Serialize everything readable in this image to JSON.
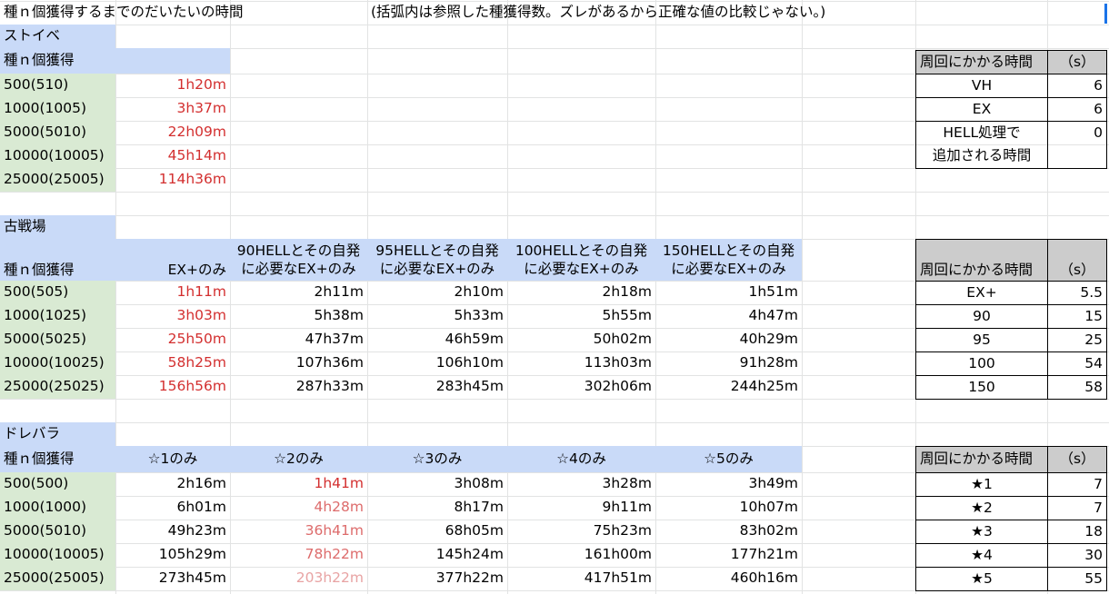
{
  "title": "種ｎ個獲得するまでのだいたいの時間",
  "note": "(括弧内は参照した種獲得数。ズレがあるから正確な値の比較じゃない。)",
  "sections": [
    {
      "name": "ストイベ",
      "header": [
        "種ｎ個獲得",
        ""
      ],
      "rows": [
        [
          "500(510)",
          "1h20m"
        ],
        [
          "1000(1005)",
          "3h37m"
        ],
        [
          "5000(5010)",
          "22h09m"
        ],
        [
          "10000(10005)",
          "45h14m"
        ],
        [
          "25000(25005)",
          "114h36m"
        ]
      ],
      "side": {
        "header": [
          "周回にかかる時間",
          "（s）"
        ],
        "rows": [
          [
            "VH",
            "6"
          ],
          [
            "EX",
            "6"
          ],
          [
            "HELL処理で",
            "0"
          ],
          [
            "追加される時間",
            ""
          ]
        ]
      }
    },
    {
      "name": "古戦場",
      "header": [
        "種ｎ個獲得",
        "EX+のみ",
        "90HELLとその自発\nに必要なEX+のみ",
        "95HELLとその自発\nに必要なEX+のみ",
        "100HELLとその自発\nに必要なEX+のみ",
        "150HELLとその自発\nに必要なEX+のみ"
      ],
      "rows": [
        [
          "500(505)",
          "1h11m",
          "2h11m",
          "2h10m",
          "2h18m",
          "1h51m"
        ],
        [
          "1000(1025)",
          "3h03m",
          "5h38m",
          "5h33m",
          "5h55m",
          "4h47m"
        ],
        [
          "5000(5025)",
          "25h50m",
          "47h37m",
          "46h59m",
          "50h02m",
          "40h29m"
        ],
        [
          "10000(10025)",
          "58h25m",
          "107h36m",
          "106h10m",
          "113h03m",
          "91h28m"
        ],
        [
          "25000(25025)",
          "156h56m",
          "287h33m",
          "283h45m",
          "302h06m",
          "244h25m"
        ]
      ],
      "side": {
        "header": [
          "周回にかかる時間",
          "（s）"
        ],
        "rows": [
          [
            "EX+",
            "5.5"
          ],
          [
            "90",
            "15"
          ],
          [
            "95",
            "25"
          ],
          [
            "100",
            "54"
          ],
          [
            "150",
            "58"
          ]
        ]
      }
    },
    {
      "name": "ドレバラ",
      "header": [
        "種ｎ個獲得",
        "☆1のみ",
        "☆2のみ",
        "☆3のみ",
        "☆4のみ",
        "☆5のみ"
      ],
      "rows": [
        [
          "500(500)",
          "2h16m",
          "1h41m",
          "3h08m",
          "3h28m",
          "3h49m"
        ],
        [
          "1000(1000)",
          "6h01m",
          "4h28m",
          "8h17m",
          "9h11m",
          "10h07m"
        ],
        [
          "5000(5010)",
          "49h23m",
          "36h41m",
          "68h05m",
          "75h23m",
          "83h02m"
        ],
        [
          "10000(10005)",
          "105h29m",
          "78h22m",
          "145h24m",
          "161h00m",
          "177h21m"
        ],
        [
          "25000(25005)",
          "273h45m",
          "203h22m",
          "377h22m",
          "417h51m",
          "460h16m"
        ]
      ],
      "side": {
        "header": [
          "周回にかかる時間",
          "（s）"
        ],
        "rows": [
          [
            "★1",
            "7"
          ],
          [
            "★2",
            "7"
          ],
          [
            "★3",
            "18"
          ],
          [
            "★4",
            "30"
          ],
          [
            "★5",
            "55"
          ]
        ]
      }
    }
  ],
  "colors": {
    "header_blue": "#c9daf8",
    "row_green": "#d9ead3",
    "side_gray": "#cccccc",
    "red": "#d32f2f",
    "pink": "#dd6b6b",
    "light_pink": "#e8a3a3",
    "gridline": "#e2e3e3"
  }
}
